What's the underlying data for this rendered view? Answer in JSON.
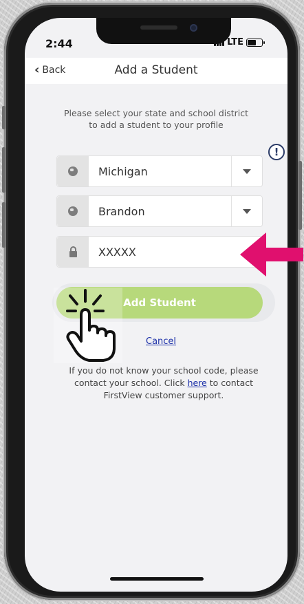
{
  "status": {
    "time": "2:44",
    "network": "LTE"
  },
  "nav": {
    "back_label": "Back",
    "title": "Add a Student"
  },
  "intro": {
    "line1": "Please select your state and school district",
    "line2": "to add a student to your profile"
  },
  "form": {
    "state": {
      "value": "Michigan",
      "icon": "globe-icon"
    },
    "district": {
      "value": "Brandon",
      "icon": "globe-icon"
    },
    "school_code": {
      "value": "XXXXX",
      "icon": "lock-icon"
    },
    "submit_label": "Add Student",
    "cancel_label": "Cancel"
  },
  "help": {
    "before_link": "If you do not know your school code, please contact your school. Click ",
    "link_text": "here",
    "after_link": " to contact FirstView customer support."
  },
  "colors": {
    "accent_green": "#b7d97b",
    "arrow_magenta": "#e0106e",
    "link_blue": "#1b2fa8"
  }
}
